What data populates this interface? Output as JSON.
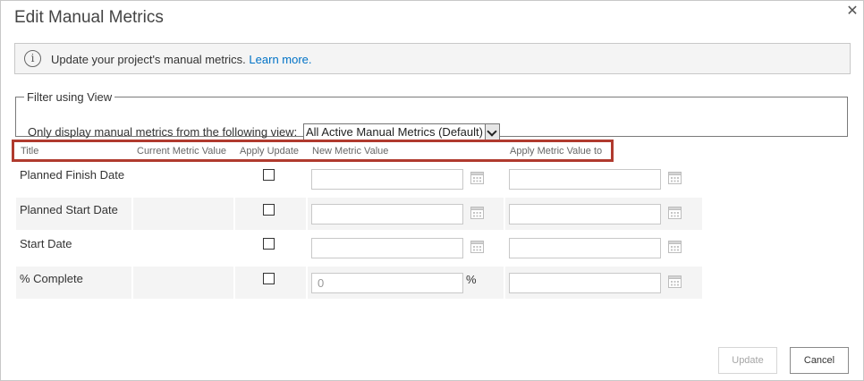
{
  "dialog": {
    "title": "Edit Manual Metrics",
    "close_glyph": "✕"
  },
  "info": {
    "icon": "info-circle-icon",
    "text": "Update your project's manual metrics.",
    "link": "Learn more."
  },
  "filter": {
    "legend": "Filter using View",
    "label": "Only display manual metrics from the following view:",
    "selected_view": "All Active Manual Metrics (Default)"
  },
  "table": {
    "headers": {
      "title": "Title",
      "current_value": "Current Metric Value",
      "apply_update": "Apply Update",
      "new_value": "New Metric Value",
      "apply_to": "Apply Metric Value to"
    },
    "rows": [
      {
        "title": "Planned Finish Date",
        "new_value": "",
        "apply_to": ""
      },
      {
        "title": "Planned Start Date",
        "new_value": "",
        "apply_to": ""
      },
      {
        "title": "Start Date",
        "new_value": "",
        "apply_to": ""
      },
      {
        "title": "% Complete",
        "new_value": "0",
        "unit": "%",
        "apply_to": ""
      }
    ]
  },
  "buttons": {
    "update": "Update",
    "cancel": "Cancel"
  },
  "colors": {
    "highlight_outline": "#b03a2e",
    "link": "#0072c6",
    "row_shade": "#f4f4f4"
  }
}
